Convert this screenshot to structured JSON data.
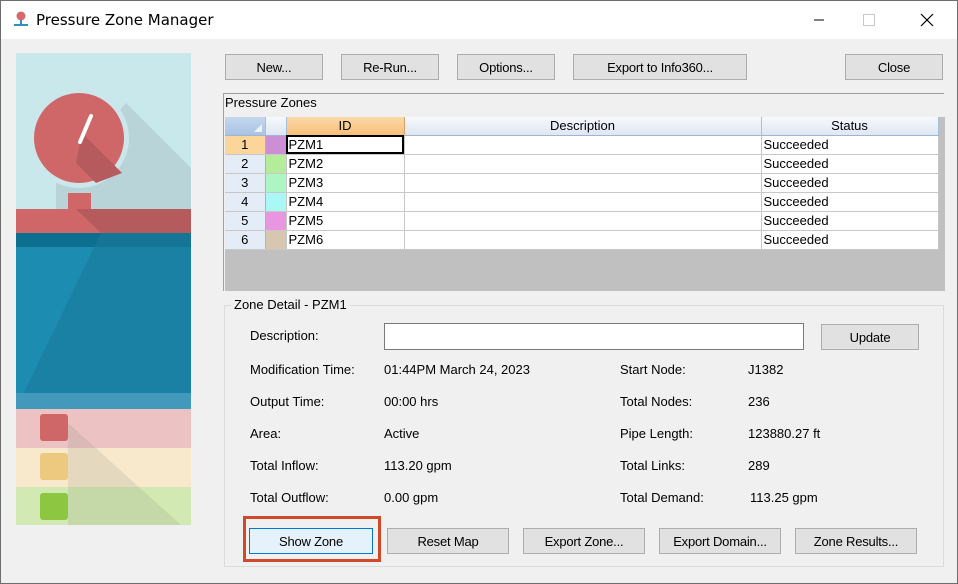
{
  "window": {
    "title": "Pressure Zone Manager",
    "controls": {
      "minimize": "minimize",
      "maximize": "maximize",
      "close": "close"
    }
  },
  "toolbar": {
    "new_label": "New...",
    "rerun_label": "Re-Run...",
    "options_label": "Options...",
    "export_info360_label": "Export to Info360...",
    "close_label": "Close"
  },
  "pressure_zones": {
    "group_label": "Pressure Zones",
    "columns": {
      "id": "ID",
      "description": "Description",
      "status": "Status"
    },
    "rows": [
      {
        "num": "1",
        "color": "#cc8fd6",
        "id": "PZM1",
        "description": "",
        "status": "Succeeded"
      },
      {
        "num": "2",
        "color": "#b4ec9a",
        "id": "PZM2",
        "description": "",
        "status": "Succeeded"
      },
      {
        "num": "3",
        "color": "#aef5c4",
        "id": "PZM3",
        "description": "",
        "status": "Succeeded"
      },
      {
        "num": "4",
        "color": "#a9f8f6",
        "id": "PZM4",
        "description": "",
        "status": "Succeeded"
      },
      {
        "num": "5",
        "color": "#e996e0",
        "id": "PZM5",
        "description": "",
        "status": "Succeeded"
      },
      {
        "num": "6",
        "color": "#d8c7b0",
        "id": "PZM6",
        "description": "",
        "status": "Succeeded"
      }
    ],
    "selected_row": 1
  },
  "zone_detail": {
    "legend": "Zone Detail - PZM1",
    "description_label": "Description:",
    "description_value": "",
    "update_label": "Update",
    "left": [
      {
        "label": "Modification Time:",
        "value": "01:44PM March 24, 2023"
      },
      {
        "label": "Output Time:",
        "value": "00:00 hrs"
      },
      {
        "label": "Area:",
        "value": "Active"
      },
      {
        "label": "Total Inflow:",
        "value": "113.20 gpm"
      },
      {
        "label": "Total Outflow:",
        "value": "0.00 gpm"
      }
    ],
    "right": [
      {
        "label": "Start Node:",
        "value": "J1382"
      },
      {
        "label": "Total Nodes:",
        "value": "236"
      },
      {
        "label": "Pipe Length:",
        "value": "123880.27 ft"
      },
      {
        "label": "Total Links:",
        "value": "289"
      },
      {
        "label": "Total Demand:",
        "value": "113.25 gpm"
      }
    ],
    "buttons": {
      "show_zone": "Show Zone",
      "reset_map": "Reset Map",
      "export_zone": "Export Zone...",
      "export_domain": "Export Domain...",
      "zone_results": "Zone Results..."
    }
  },
  "colors": {
    "highlight": "#d04a2a",
    "selected_header": "#f7c07a"
  }
}
